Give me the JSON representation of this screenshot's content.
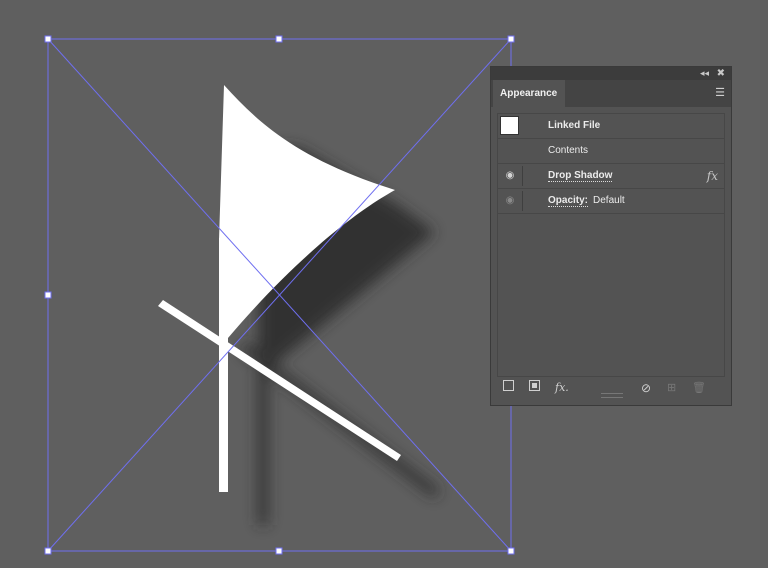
{
  "panel": {
    "tab": "Appearance",
    "rows": [
      {
        "label": "Linked File"
      },
      {
        "label": "Contents"
      },
      {
        "label": "Drop Shadow",
        "fx": "fx"
      },
      {
        "label": "Opacity:",
        "value": "Default"
      }
    ],
    "icons": {
      "collapse": "◂◂",
      "close": "✖",
      "menu": "☰",
      "eye": "👁",
      "fx": "fx",
      "add_fx": "fx."
    }
  },
  "colors": {
    "canvas": "#5f5f5f",
    "selection": "#6f6ff0",
    "art": "#ffffff"
  }
}
